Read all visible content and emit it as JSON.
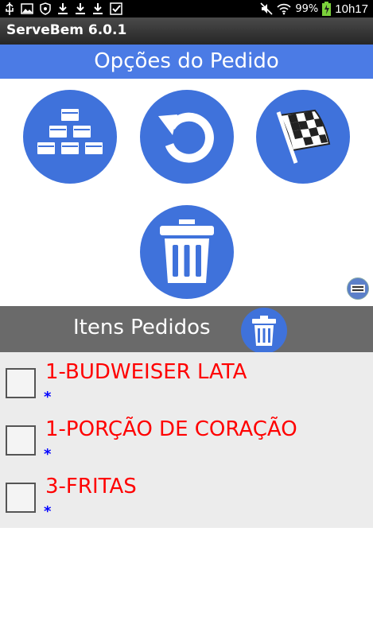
{
  "status_bar": {
    "left_icons": [
      "usb-icon",
      "image-icon",
      "shield-icon",
      "download-icon",
      "download-icon",
      "download-icon",
      "check-icon"
    ],
    "battery": "99%",
    "time": "10h17"
  },
  "app": {
    "title": "ServeBem 6.0.1"
  },
  "order_options": {
    "header": "Opções do Pedido",
    "buttons": [
      {
        "icon": "boxes-stack-icon"
      },
      {
        "icon": "undo-icon"
      },
      {
        "icon": "checkered-flag-icon"
      },
      {
        "icon": "trash-icon"
      }
    ]
  },
  "items": {
    "header": "Itens Pedidos",
    "list": [
      {
        "label": "1-BUDWEISER LATA",
        "note": "*"
      },
      {
        "label": "1-PORÇÃO DE CORAÇÃO",
        "note": "*"
      },
      {
        "label": "3-FRITAS",
        "note": "*"
      }
    ]
  },
  "colors": {
    "accent": "#3f72db",
    "header_blue": "#4b7be5",
    "item_text": "#ff0000",
    "note_text": "#0000ff"
  }
}
